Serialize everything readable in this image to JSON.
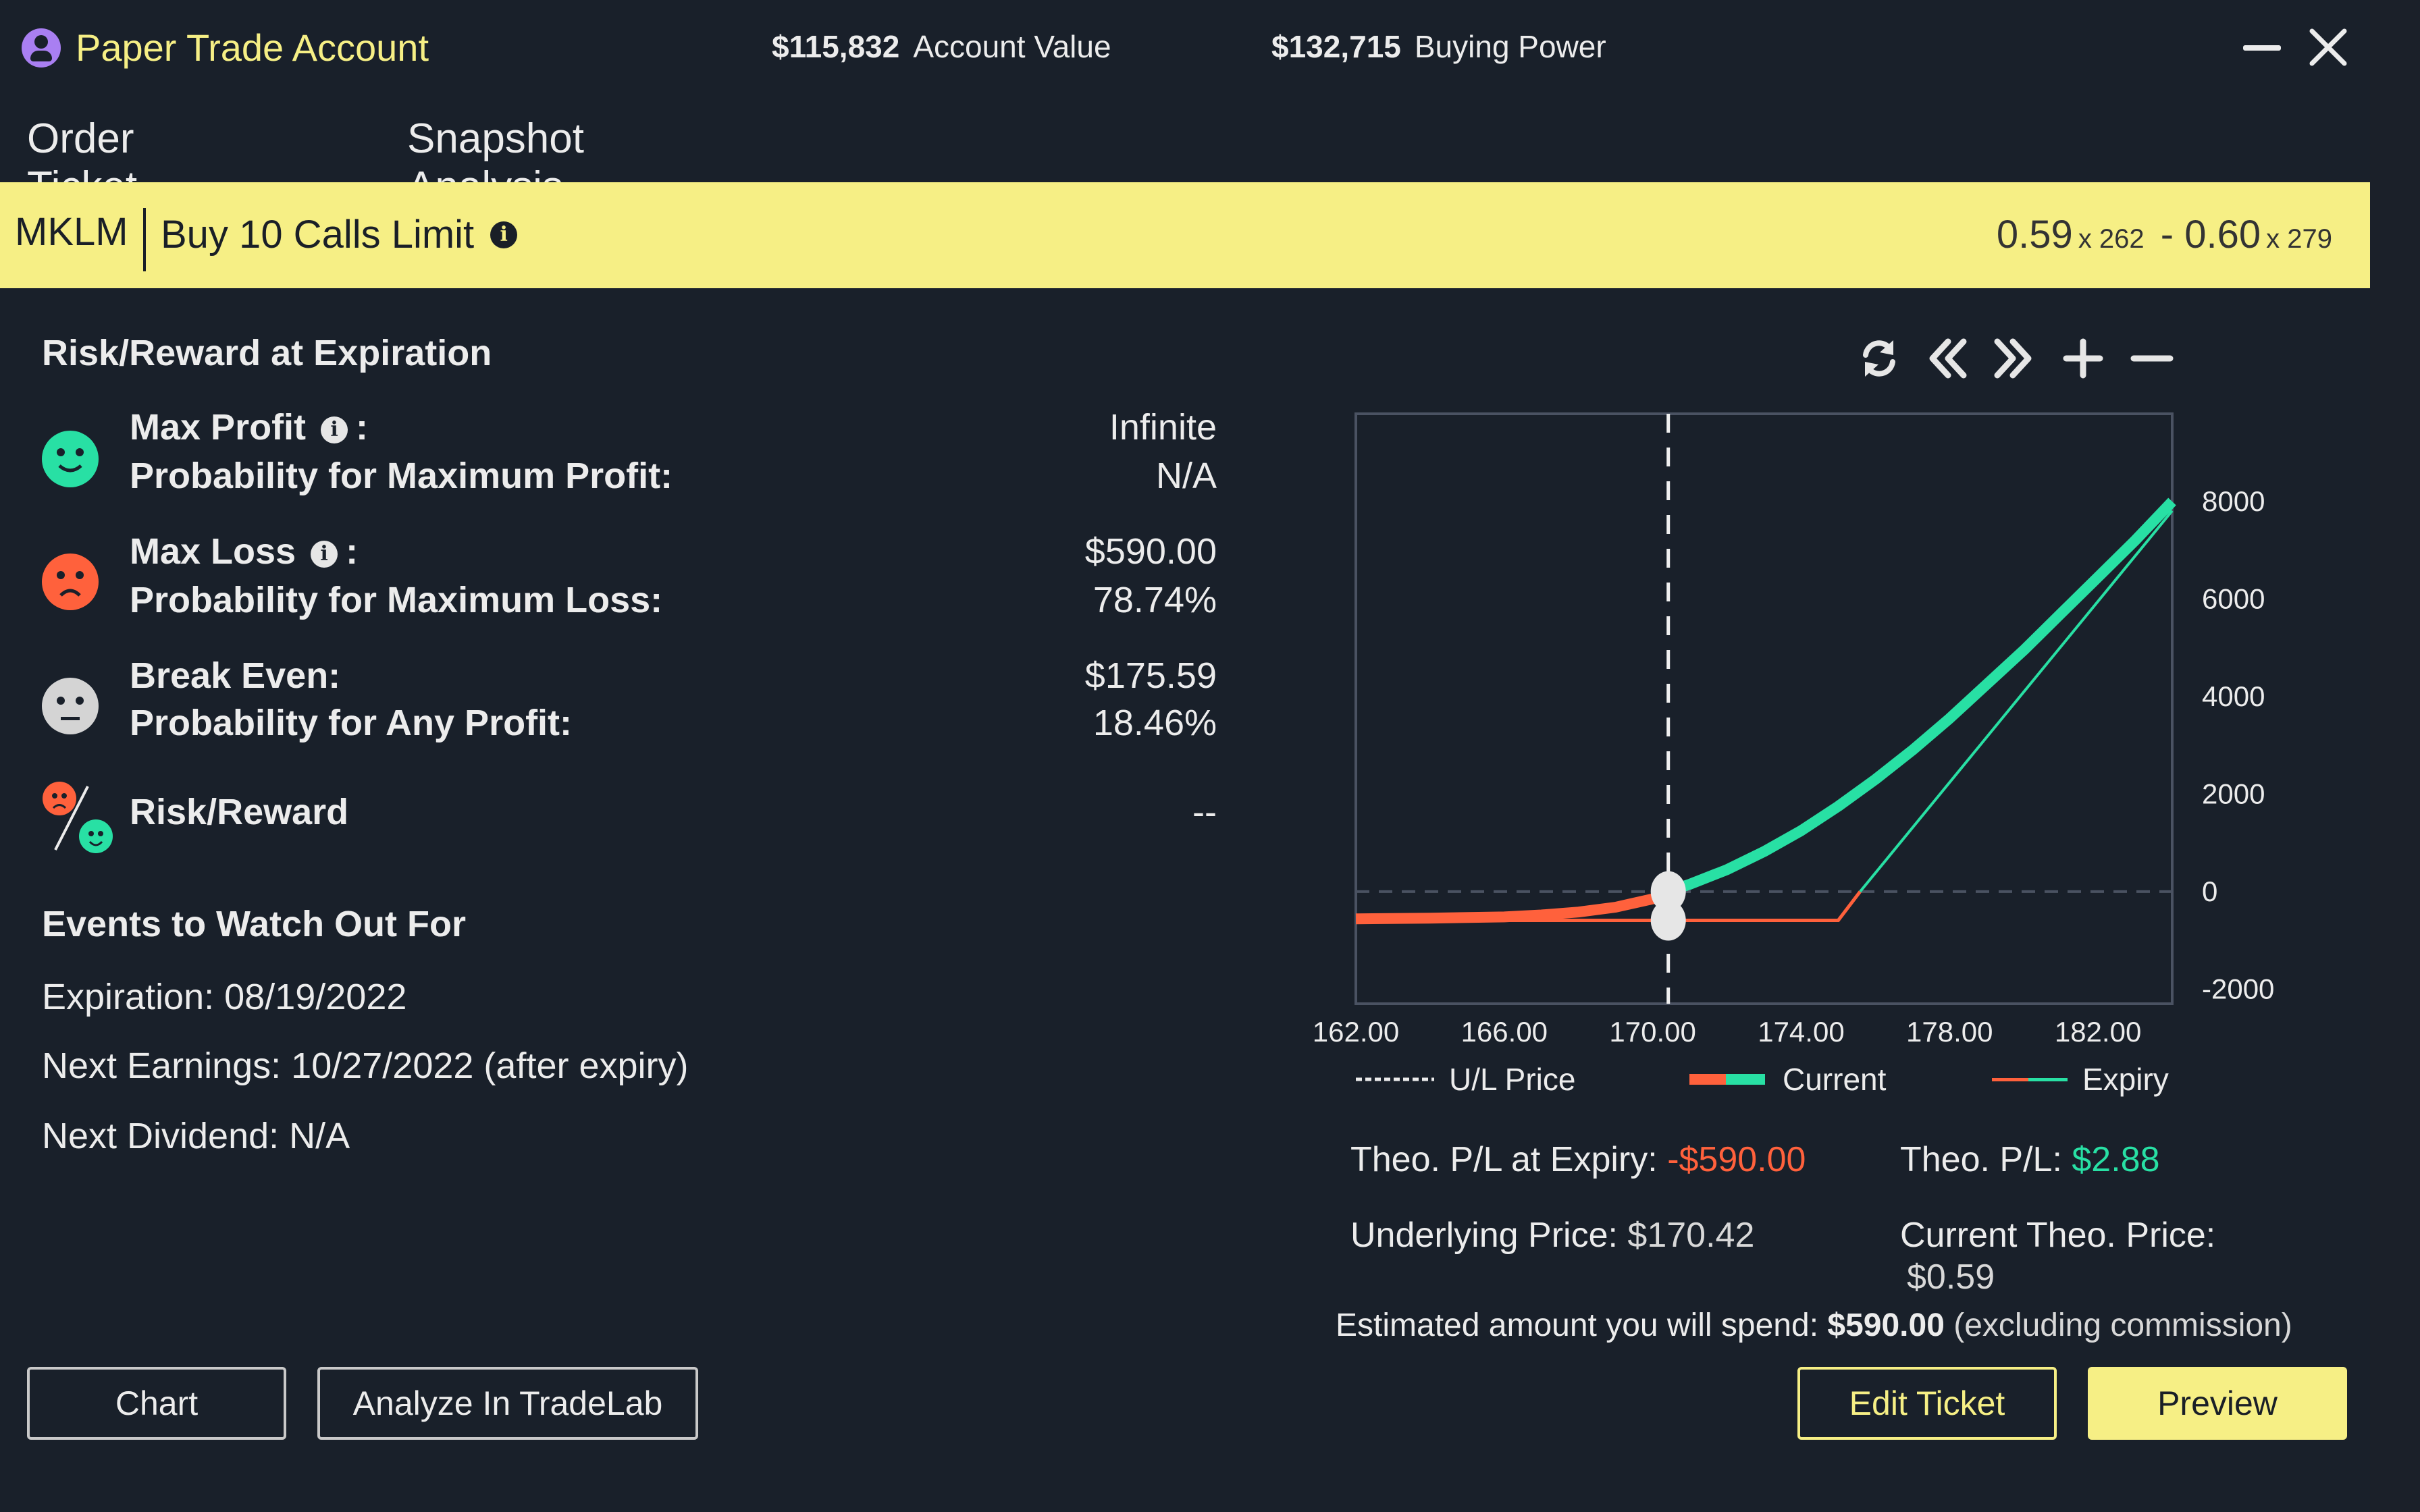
{
  "header": {
    "account_name": "Paper Trade Account",
    "account_value": "$115,832",
    "account_value_label": "Account Value",
    "buying_power": "$132,715",
    "buying_power_label": "Buying Power"
  },
  "tabs": [
    {
      "label": "Order Ticket",
      "active": false
    },
    {
      "label": "Snapshot Analysis",
      "active": true
    }
  ],
  "order": {
    "symbol": "MKLM",
    "description": "Buy 10 Calls Limit",
    "bid": "0.59",
    "bid_size": "x 262",
    "separator": "-",
    "ask": "0.60",
    "ask_size": "x 279"
  },
  "risk_reward": {
    "title": "Risk/Reward at Expiration",
    "max_profit_label": "Max Profit",
    "max_profit_value": "Infinite",
    "prob_max_profit_label": "Probability for Maximum Profit:",
    "prob_max_profit_value": "N/A",
    "max_loss_label": "Max Loss",
    "max_loss_value": "$590.00",
    "prob_max_loss_label": "Probability for Maximum Loss:",
    "prob_max_loss_value": "78.74%",
    "break_even_label": "Break Even:",
    "break_even_value": "$175.59",
    "prob_any_profit_label": "Probability for Any Profit:",
    "prob_any_profit_value": "18.46%",
    "risk_reward_label": "Risk/Reward",
    "risk_reward_value": "--",
    "colon": ":"
  },
  "events": {
    "title": "Events to Watch Out For",
    "items": [
      "Expiration: 08/19/2022",
      "Next Earnings: 10/27/2022 (after expiry)",
      "Next Dividend: N/A"
    ]
  },
  "colors": {
    "profit": "#28e0a4",
    "loss": "#ff613c",
    "accent": "#f6ef85",
    "tab_underline": "#a97ff2"
  },
  "chart_data": {
    "type": "line",
    "title": "",
    "xlabel": "",
    "ylabel": "",
    "x_ticks": [
      "162.00",
      "166.00",
      "170.00",
      "174.00",
      "178.00",
      "182.00"
    ],
    "y_ticks": [
      "8000",
      "6000",
      "4000",
      "2000",
      "0",
      "-2000"
    ],
    "xlim": [
      162,
      184
    ],
    "ylim": [
      -2300,
      9800
    ],
    "underlying_price": 170.42,
    "series": [
      {
        "name": "Current",
        "x": [
          162,
          164,
          166,
          167,
          168,
          169,
          170,
          170.42,
          171,
          172,
          173,
          174,
          175,
          176,
          177,
          178,
          179,
          180,
          181,
          182,
          183,
          184
        ],
        "y": [
          -560,
          -545,
          -520,
          -480,
          -420,
          -320,
          -150,
          2.88,
          150,
          450,
          820,
          1250,
          1750,
          2300,
          2900,
          3550,
          4250,
          4950,
          5700,
          6450,
          7200,
          8000
        ]
      },
      {
        "name": "Expiry",
        "x": [
          162,
          170.42,
          175,
          175.59,
          184
        ],
        "y": [
          -590,
          -590,
          -590,
          0,
          7810
        ]
      }
    ],
    "legend": [
      "U/L Price",
      "Current",
      "Expiry"
    ],
    "legend_position": "bottom"
  },
  "chart_tools": [
    "refresh-icon",
    "double-chevron-left-icon",
    "double-chevron-right-icon",
    "zoom-in-icon",
    "zoom-out-icon"
  ],
  "summary": {
    "theo_pl_expiry_label": "Theo. P/L at Expiry:",
    "theo_pl_expiry_value": "-$590.00",
    "theo_pl_label": "Theo. P/L:",
    "theo_pl_value": "$2.88",
    "underlying_label": "Underlying Price:",
    "underlying_value": "$170.42",
    "current_theo_label": "Current Theo. Price:",
    "current_theo_value": "$0.59",
    "estimate_prefix": "Estimated amount you will spend:",
    "estimate_amount": "$590.00",
    "estimate_suffix": "(excluding commission)"
  },
  "buttons": {
    "chart": "Chart",
    "analyze": "Analyze In TradeLab",
    "edit": "Edit Ticket",
    "preview": "Preview"
  }
}
